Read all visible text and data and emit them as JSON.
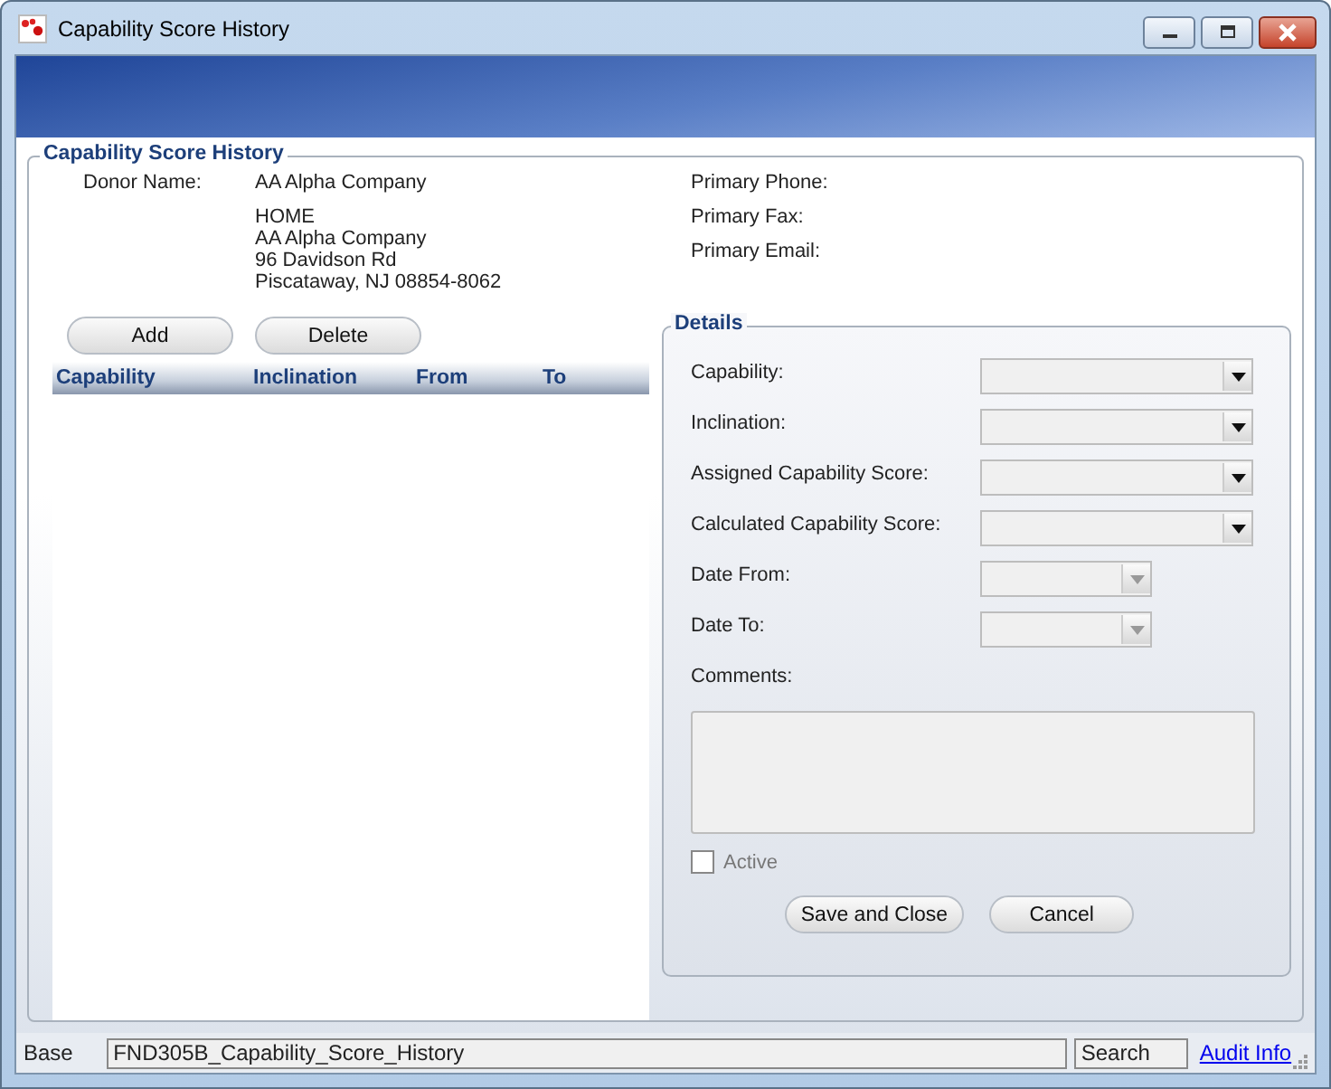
{
  "window": {
    "title": "Capability Score History"
  },
  "group_title": "Capability Score History",
  "donor": {
    "label": "Donor Name:",
    "name": "AA Alpha Company",
    "address": [
      "HOME",
      "AA Alpha Company",
      "96 Davidson Rd",
      "Piscataway, NJ 08854-8062"
    ]
  },
  "contact": [
    {
      "label": "Primary Phone:"
    },
    {
      "label": "Primary Fax:"
    },
    {
      "label": "Primary Email:"
    }
  ],
  "list_buttons": [
    "Add",
    "Delete"
  ],
  "table": {
    "columns": [
      "Capability",
      "Inclination",
      "From",
      "To"
    ]
  },
  "details": {
    "title": "Details",
    "fields": [
      {
        "kind": "combo",
        "label": "Capability:"
      },
      {
        "kind": "combo",
        "label": "Inclination:"
      },
      {
        "kind": "combo",
        "label": "Assigned Capability Score:"
      },
      {
        "kind": "combo",
        "label": "Calculated Capability Score:"
      },
      {
        "kind": "date",
        "label": "Date From:"
      },
      {
        "kind": "date",
        "label": "Date To:"
      }
    ],
    "comments_label": "Comments:",
    "active": {
      "label": "Active",
      "checked": false,
      "disabled": true
    },
    "buttons": [
      "Save and Close",
      "Cancel"
    ]
  },
  "status_bar": {
    "mode": "Base",
    "form": "FND305B_Capability_Score_History",
    "search": "Search",
    "link": "Audit Info"
  }
}
